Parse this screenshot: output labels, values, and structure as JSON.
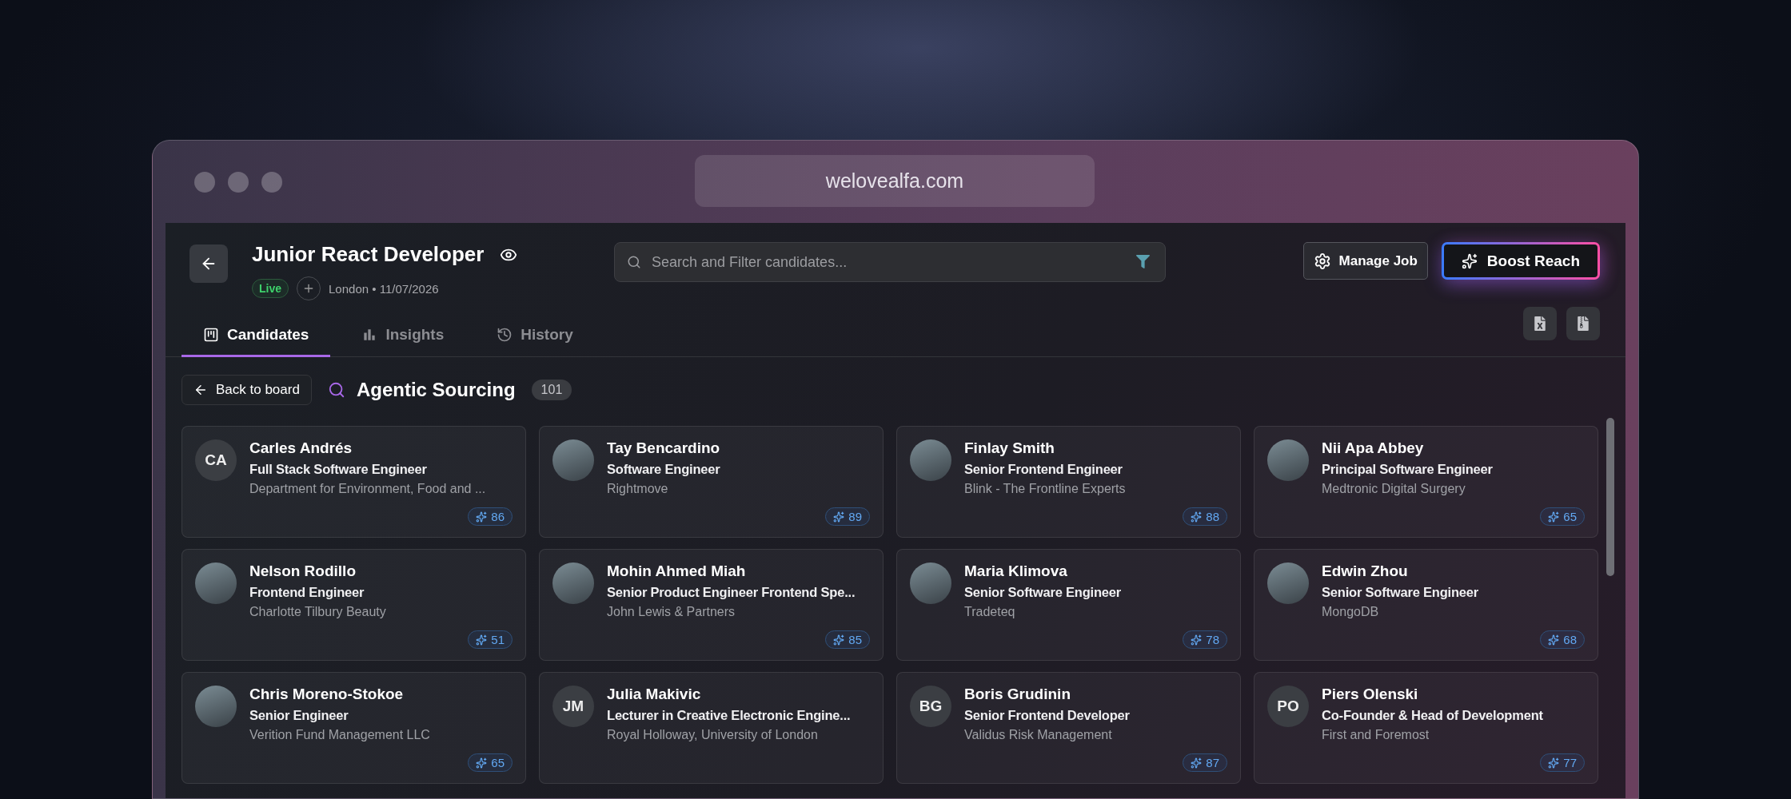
{
  "browser": {
    "url": "welovealfa.com"
  },
  "job": {
    "title": "Junior React Developer",
    "status": "Live",
    "location_date": "London • 11/07/2026"
  },
  "search": {
    "placeholder": "Search and Filter candidates..."
  },
  "manage_button": "Manage Job",
  "boost_button": "Boost Reach",
  "tabs": [
    {
      "label": "Candidates",
      "kind": "board",
      "selected": true
    },
    {
      "label": "Insights",
      "kind": "chart",
      "selected": false
    },
    {
      "label": "History",
      "kind": "history",
      "selected": false
    }
  ],
  "back_link": "Back to board",
  "section": {
    "title": "Agentic Sourcing",
    "count": "101"
  },
  "candidates": [
    {
      "name": "Carles Andrés",
      "title": "Full Stack Software Engineer",
      "company": "Department for Environment, Food and ...",
      "score": "86",
      "kind": "initials",
      "initials": "CA"
    },
    {
      "name": "Tay Bencardino",
      "title": "Software Engineer",
      "company": "Rightmove",
      "score": "89",
      "kind": "photo"
    },
    {
      "name": "Finlay Smith",
      "title": "Senior Frontend Engineer",
      "company": "Blink - The Frontline Experts",
      "score": "88",
      "kind": "photo"
    },
    {
      "name": "Nii Apa Abbey",
      "title": "Principal Software Engineer",
      "company": "Medtronic Digital Surgery",
      "score": "65",
      "kind": "photo"
    },
    {
      "name": "Nelson Rodillo",
      "title": "Frontend Engineer",
      "company": "Charlotte Tilbury Beauty",
      "score": "51",
      "kind": "photo"
    },
    {
      "name": "Mohin Ahmed Miah",
      "title": "Senior Product Engineer Frontend Spe...",
      "company": "John Lewis & Partners",
      "score": "85",
      "kind": "photo"
    },
    {
      "name": "Maria Klimova",
      "title": "Senior Software Engineer",
      "company": "Tradeteq",
      "score": "78",
      "kind": "photo"
    },
    {
      "name": "Edwin Zhou",
      "title": "Senior Software Engineer",
      "company": "MongoDB",
      "score": "68",
      "kind": "photo"
    },
    {
      "name": "Chris Moreno-Stokoe",
      "title": "Senior Engineer",
      "company": "Verition Fund Management LLC",
      "score": "65",
      "kind": "photo"
    },
    {
      "name": "Julia Makivic",
      "title": "Lecturer in Creative Electronic Engine...",
      "company": "Royal Holloway, University of London",
      "kind": "initials",
      "initials": "JM"
    },
    {
      "name": "Boris Grudinin",
      "title": "Senior Frontend Developer",
      "company": "Validus Risk Management",
      "score": "87",
      "kind": "initials",
      "initials": "BG"
    },
    {
      "name": "Piers Olenski",
      "title": "Co-Founder & Head of Development",
      "company": "First and Foremost",
      "score": "77",
      "kind": "initials",
      "initials": "PO"
    }
  ]
}
